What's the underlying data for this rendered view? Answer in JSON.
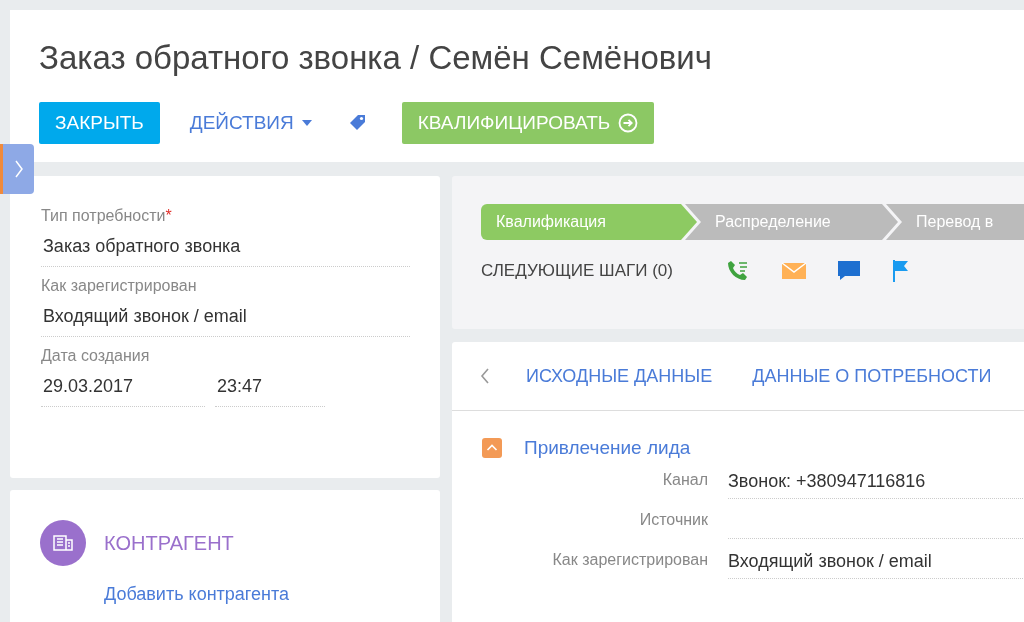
{
  "header": {
    "title": "Заказ обратного звонка / Семён Семёнович",
    "buttons": [
      {
        "kind": "primary",
        "label": "ЗАКРЫТЬ"
      },
      {
        "kind": "menu",
        "label": "ДЕЙСТВИЯ"
      },
      {
        "kind": "tag"
      },
      {
        "kind": "success",
        "label": "КВАЛИФИЦИРОВАТЬ"
      }
    ]
  },
  "details": {
    "fields": [
      {
        "label": "Тип потребности",
        "required_mark": "*",
        "values": [
          "Заказ обратного звонка"
        ]
      },
      {
        "label": "Как зарегистрирован",
        "values": [
          "Входящий звонок / email"
        ]
      },
      {
        "label": "Дата создания",
        "values": [
          "29.03.2017",
          "23:47"
        ]
      }
    ]
  },
  "account": {
    "title": "КОНТРАГЕНТ",
    "link": "Добавить контрагента"
  },
  "stages": [
    {
      "label": "Квалификация",
      "selected": true
    },
    {
      "label": "Распределение",
      "selected": false
    },
    {
      "label": "Перевод в",
      "selected": false
    }
  ],
  "next_steps": {
    "label": "СЛЕДУЮЩИЕ ШАГИ (0)"
  },
  "tabs": [
    "ИСХОДНЫЕ ДАННЫЕ",
    "ДАННЫЕ О ПОТРЕБНОСТИ"
  ],
  "section": {
    "title": "Привлечение лида",
    "expanded": true,
    "rows": [
      {
        "label": "Канал",
        "value": "Звонок: +380947116816"
      },
      {
        "label": "Источник"
      },
      {
        "label": "Как зарегистрирован",
        "value": "Входящий звонок / email"
      }
    ]
  }
}
